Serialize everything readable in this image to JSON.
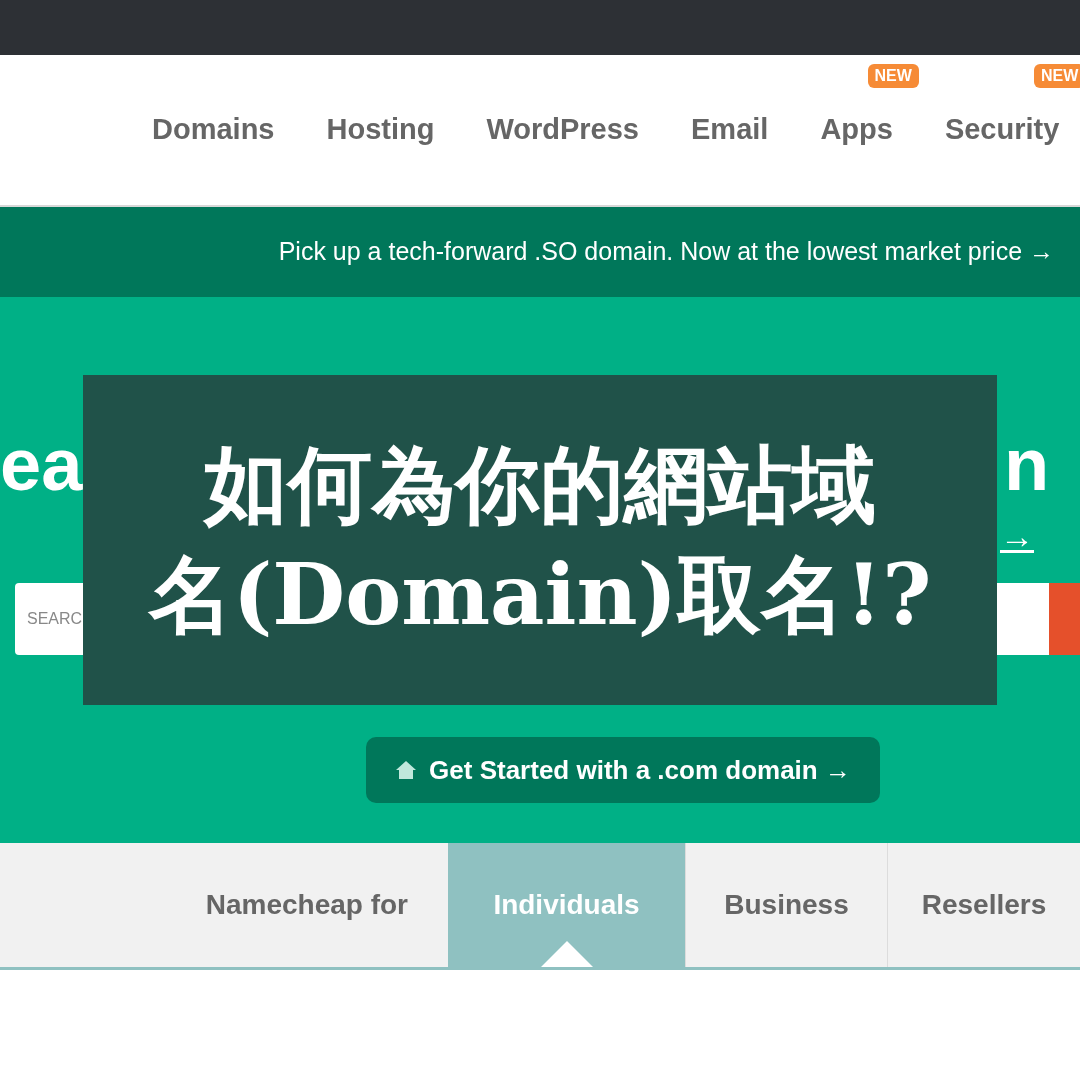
{
  "nav": {
    "items": [
      {
        "label": "Domains"
      },
      {
        "label": "Hosting"
      },
      {
        "label": "WordPress"
      },
      {
        "label": "Email"
      },
      {
        "label": "Apps",
        "badge": "NEW"
      },
      {
        "label": "Security",
        "badge": "NEW"
      }
    ]
  },
  "promo_bar": {
    "text": "Pick up a tech-forward .SO domain. Now at the lowest market price →"
  },
  "hero": {
    "heading_left": "ea",
    "heading_right": "n",
    "link_end": "→",
    "search": {
      "label": "SEARC"
    },
    "cta": "Get Started with a .com domain →"
  },
  "overlay": {
    "title_lines": [
      "如何為你的網站域",
      "名(Domain)取名!?"
    ]
  },
  "audience_tabs": {
    "label": "Namecheap for",
    "tabs": [
      {
        "label": "Individuals",
        "selected": true
      },
      {
        "label": "Business",
        "selected": false
      },
      {
        "label": "Resellers",
        "selected": false
      }
    ]
  }
}
